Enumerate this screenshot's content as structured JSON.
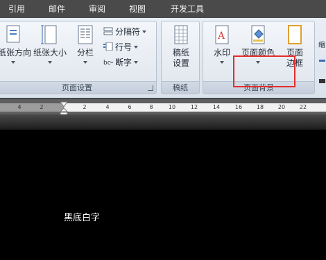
{
  "tabs": [
    "引用",
    "邮件",
    "审阅",
    "视图",
    "开发工具"
  ],
  "page_setup_group": {
    "label": "页面设置",
    "orientation": "纸张方向",
    "size": "纸张大小",
    "columns": "分栏",
    "breaks": "分隔符",
    "line_numbers": "行号",
    "hyphenation": "断字"
  },
  "manuscript_group": {
    "label": "稿纸",
    "manuscript_settings_line1": "稿纸",
    "manuscript_settings_line2": "设置"
  },
  "page_background_group": {
    "label": "页面背景",
    "watermark": "水印",
    "page_color": "页面颜色",
    "page_border_line1": "页面",
    "page_border_line2": "边框"
  },
  "ruler_ticks": [
    "4",
    "2",
    "2",
    "4",
    "6",
    "8",
    "10",
    "12",
    "14",
    "16",
    "18",
    "20",
    "22"
  ],
  "document_text": "黑底白字",
  "right_partial_text": "缩"
}
